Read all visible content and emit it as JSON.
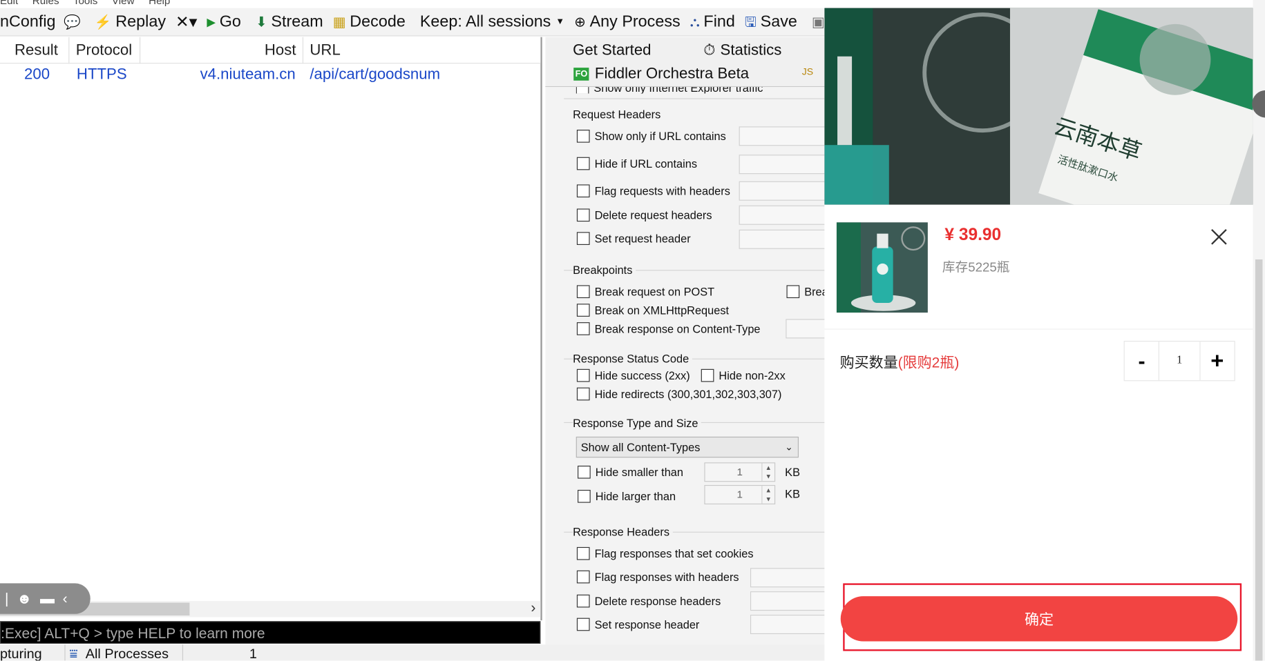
{
  "menu": [
    "Edit",
    "Rules",
    "Tools",
    "View",
    "Help"
  ],
  "toolbar": {
    "winconfig": "nConfig",
    "replay": "Replay",
    "remove": "✕▾",
    "go": "Go",
    "stream": "Stream",
    "decode": "Decode",
    "keep": "Keep: All sessions",
    "any_process": "Any Process",
    "find": "Find",
    "save": "Save"
  },
  "sessions": {
    "columns": {
      "result": "Result",
      "protocol": "Protocol",
      "host": "Host",
      "url": "URL"
    },
    "rows": [
      {
        "result": "200",
        "protocol": "HTTPS",
        "host": "v4.niuteam.cn",
        "url": "/api/cart/goodsnum"
      }
    ]
  },
  "quickexec": ":Exec] ALT+Q > type HELP to learn more",
  "status": {
    "capturing": "pturing",
    "processes": "All Processes",
    "count": "1"
  },
  "tabs": {
    "get_started": "Get Started",
    "statistics": "Statistics",
    "orchestra_icon": "FO",
    "orchestra": "Fiddler Orchestra Beta"
  },
  "filters": {
    "clipped": "Show only Internet Explorer traffic",
    "request_headers": {
      "title": "Request Headers",
      "items": [
        "Show only if URL contains",
        "Hide if URL contains",
        "Flag requests with headers",
        "Delete request headers",
        "Set request header"
      ]
    },
    "breakpoints": {
      "title": "Breakpoints",
      "items": [
        "Break request on POST",
        "Break on XMLHttpRequest",
        "Break response on Content-Type"
      ],
      "extra": "Brea"
    },
    "status_code": {
      "title": "Response Status Code",
      "hide_success": "Hide success (2xx)",
      "hide_non2xx": "Hide non-2xx",
      "hide_redirects": "Hide redirects (300,301,302,303,307)"
    },
    "type_size": {
      "title": "Response Type and Size",
      "content_types": "Show all Content-Types",
      "hide_smaller": "Hide smaller than",
      "hide_larger": "Hide larger than",
      "smaller_value": "1",
      "larger_value": "1",
      "unit": "KB"
    },
    "response_headers": {
      "title": "Response Headers",
      "items": [
        "Flag responses that set cookies",
        "Flag responses with headers",
        "Delete response headers",
        "Set response header"
      ]
    }
  },
  "product": {
    "price": "¥ 39.90",
    "stock": "库存5225瓶",
    "qty_label": "购买数量",
    "limit": "(限购2瓶)",
    "minus": "-",
    "qty": "1",
    "plus": "+",
    "confirm": "确定",
    "box_brand": "云南本草",
    "box_sub": "活性肽漱口水"
  },
  "colors": {
    "accent_red": "#f24442",
    "price_red": "#e92f2f",
    "link_blue": "#1a47c8"
  }
}
